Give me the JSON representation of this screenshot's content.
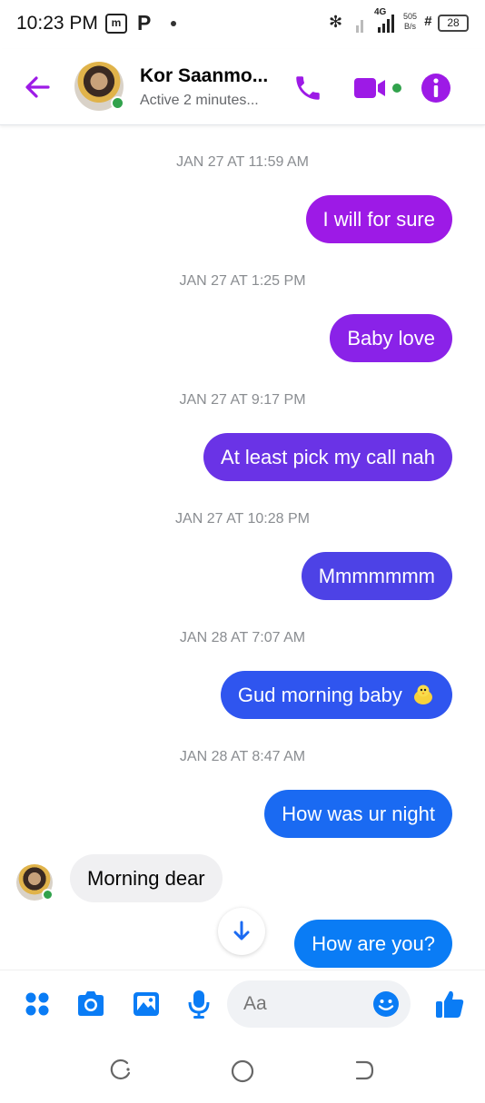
{
  "status_bar": {
    "time": "10:23 PM",
    "icon_box": "m",
    "p_icon": "P",
    "net_4g": "4G",
    "speed_value": "505",
    "speed_unit": "B/s",
    "battery": "28"
  },
  "header": {
    "contact_name": "Kor Saanmo...",
    "status": "Active 2 minutes..."
  },
  "colors": {
    "accent_purple": "#9d1ae6",
    "accent_blue": "#0a7cf5",
    "online_green": "#31a24c"
  },
  "messages": [
    {
      "type": "timestamp",
      "text": "JAN 27 AT 11:59 AM"
    },
    {
      "type": "outgoing",
      "text": "I will for sure"
    },
    {
      "type": "timestamp",
      "text": "JAN 27 AT 1:25 PM"
    },
    {
      "type": "outgoing",
      "text": "Baby love"
    },
    {
      "type": "timestamp",
      "text": "JAN 27 AT 9:17 PM"
    },
    {
      "type": "outgoing",
      "text": "At least pick my call nah"
    },
    {
      "type": "timestamp",
      "text": "JAN 27 AT 10:28 PM"
    },
    {
      "type": "outgoing",
      "text": "Mmmmmmm"
    },
    {
      "type": "timestamp",
      "text": "JAN 28 AT 7:07 AM"
    },
    {
      "type": "outgoing",
      "text": "Gud morning baby"
    },
    {
      "type": "timestamp",
      "text": "JAN 28 AT 8:47 AM"
    },
    {
      "type": "outgoing",
      "text": "How was ur night"
    },
    {
      "type": "incoming",
      "text": "Morning dear"
    },
    {
      "type": "outgoing",
      "text": "How are you?"
    }
  ],
  "composer": {
    "placeholder": "Aa"
  },
  "icons": {
    "header": [
      "back-arrow-icon",
      "phone-icon",
      "video-camera-icon",
      "info-icon"
    ],
    "composer": [
      "apps-icon",
      "camera-icon",
      "gallery-icon",
      "microphone-icon",
      "emoji-icon",
      "thumbs-up-icon"
    ],
    "nav": [
      "recents-icon",
      "home-icon",
      "back-icon"
    ]
  }
}
